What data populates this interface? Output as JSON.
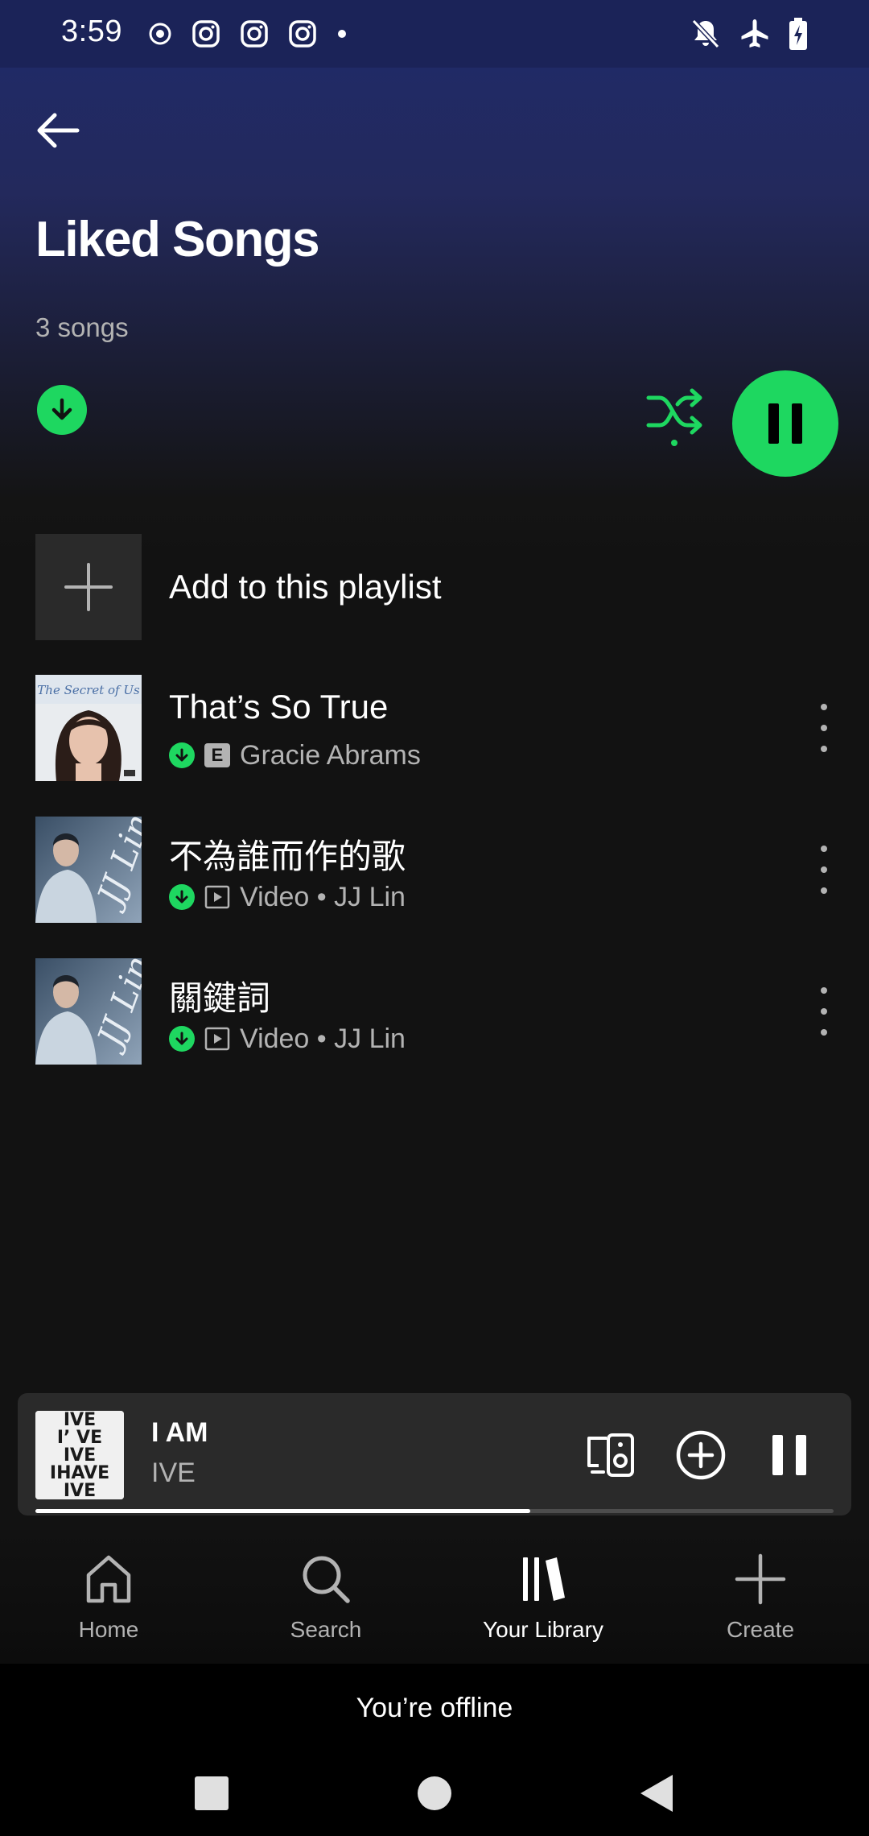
{
  "status_bar": {
    "time": "3:59",
    "left_icons": [
      "record-icon",
      "instagram-icon",
      "instagram-icon",
      "instagram-icon",
      "dot-icon"
    ],
    "right_icons": [
      "notifications-off-icon",
      "airplane-mode-icon",
      "battery-charging-icon"
    ]
  },
  "header": {
    "title": "Liked Songs",
    "song_count": "3 songs"
  },
  "colors": {
    "accent": "#1ed760",
    "header_gradient_top": "#1f2a6b",
    "background": "#121212"
  },
  "add_row": {
    "label": "Add to this playlist"
  },
  "tracks": [
    {
      "title": "That’s So True",
      "explicit_badge": "E",
      "artist": "Gracie Abrams",
      "meta_icon": "explicit-icon",
      "downloaded": true
    },
    {
      "title": "不為誰而作的歌",
      "artist": "Video • JJ Lin",
      "meta_icon": "video-icon",
      "downloaded": true
    },
    {
      "title": "關鍵詞",
      "artist": "Video • JJ Lin",
      "meta_icon": "video-icon",
      "downloaded": true
    }
  ],
  "mini_player": {
    "title": "I AM",
    "artist": "IVE",
    "progress": 0.62,
    "art_text": [
      "IVE",
      "I’  VE",
      "IVE",
      "IHAVE",
      "IVE"
    ]
  },
  "nav": {
    "items": [
      {
        "label": "Home",
        "icon": "home-icon",
        "active": false
      },
      {
        "label": "Search",
        "icon": "search-icon",
        "active": false
      },
      {
        "label": "Your Library",
        "icon": "library-icon",
        "active": true
      },
      {
        "label": "Create",
        "icon": "plus-icon",
        "active": false
      }
    ]
  },
  "offline": {
    "text": "You’re offline"
  }
}
